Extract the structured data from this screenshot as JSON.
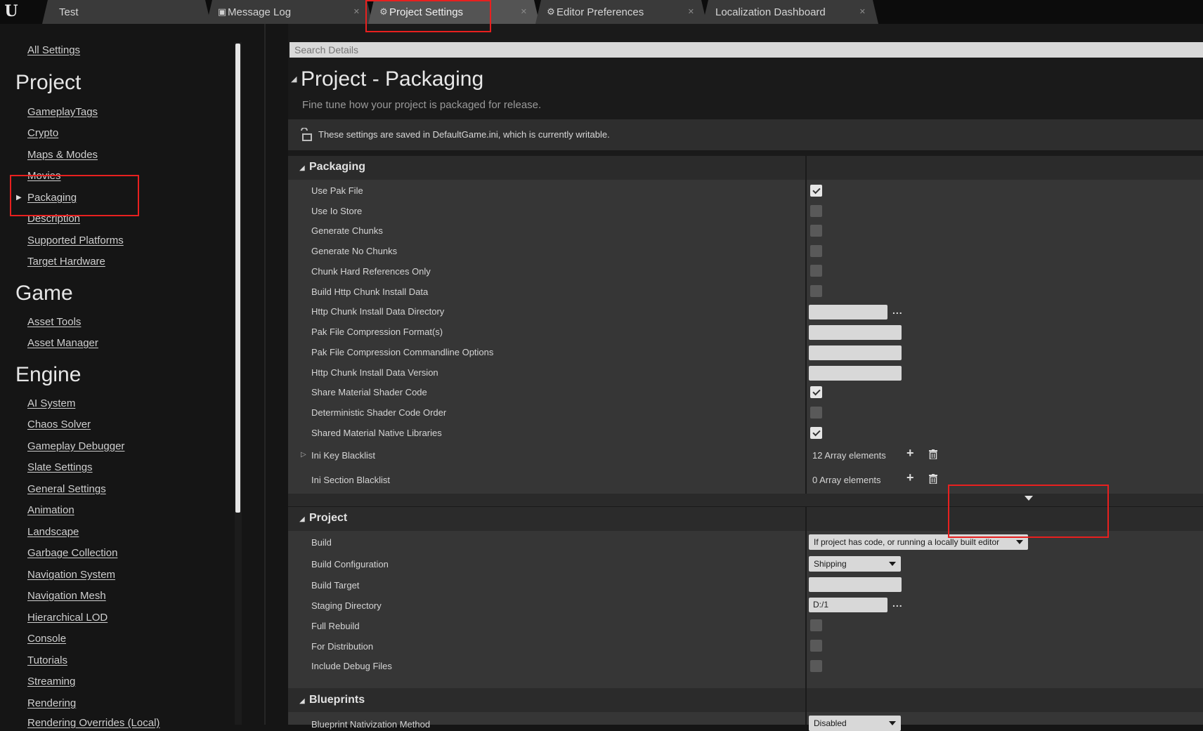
{
  "tabs": [
    {
      "label": "Test"
    },
    {
      "label": "Message Log"
    },
    {
      "label": "Project Settings"
    },
    {
      "label": "Editor Preferences"
    },
    {
      "label": "Localization Dashboard"
    }
  ],
  "sidebar": {
    "all_settings": "All Settings",
    "project_heading": "Project",
    "project_items": [
      "GameplayTags",
      "Crypto",
      "Maps & Modes",
      "Movies",
      "Packaging",
      "Description",
      "Supported Platforms",
      "Target Hardware"
    ],
    "game_heading": "Game",
    "game_items": [
      "Asset Tools",
      "Asset Manager"
    ],
    "engine_heading": "Engine",
    "engine_items": [
      "AI System",
      "Chaos Solver",
      "Gameplay Debugger",
      "Slate Settings",
      "General Settings",
      "Animation",
      "Landscape",
      "Garbage Collection",
      "Navigation System",
      "Navigation Mesh",
      "Hierarchical LOD",
      "Console",
      "Tutorials",
      "Streaming",
      "Rendering",
      "Rendering Overrides (Local)"
    ]
  },
  "search": {
    "placeholder": "Search Details"
  },
  "page": {
    "title": "Project - Packaging",
    "subtitle": "Fine tune how your project is packaged for release.",
    "notice": "These settings are saved in DefaultGame.ini, which is currently writable."
  },
  "packaging": {
    "title": "Packaging",
    "rows": {
      "use_pak_file": "Use Pak File",
      "use_io_store": "Use Io Store",
      "generate_chunks": "Generate Chunks",
      "generate_no_chunks": "Generate No Chunks",
      "chunk_hard_refs": "Chunk Hard References Only",
      "build_http_chunk": "Build Http Chunk Install Data",
      "http_chunk_dir": "Http Chunk Install Data Directory",
      "pak_compression_formats": "Pak File Compression Format(s)",
      "pak_compression_cmdline": "Pak File Compression Commandline Options",
      "http_chunk_version": "Http Chunk Install Data Version",
      "share_material_shader": "Share Material Shader Code",
      "deterministic_shader": "Deterministic Shader Code Order",
      "shared_material_native": "Shared Material Native Libraries",
      "ini_key_blacklist": "Ini Key Blacklist",
      "ini_section_blacklist": "Ini Section Blacklist"
    },
    "ini_key_count": "12 Array elements",
    "ini_section_count": "0 Array elements",
    "ellipsis": "..."
  },
  "project": {
    "title": "Project",
    "rows": {
      "build": "Build",
      "build_configuration": "Build Configuration",
      "build_target": "Build Target",
      "staging_directory": "Staging Directory",
      "full_rebuild": "Full Rebuild",
      "for_distribution": "For Distribution",
      "include_debug_files": "Include Debug Files"
    },
    "build_value": "If project has code, or running a locally built editor",
    "build_configuration_value": "Shipping",
    "staging_directory_value": "D:/1",
    "ellipsis": "..."
  },
  "blueprints": {
    "title": "Blueprints",
    "nativization_label": "Blueprint Nativization Method",
    "nativization_value": "Disabled"
  },
  "colors": {
    "highlight": "#e8201f",
    "panel": "#363636",
    "section_header": "#2b2b2b",
    "active_tab": "#545454"
  }
}
